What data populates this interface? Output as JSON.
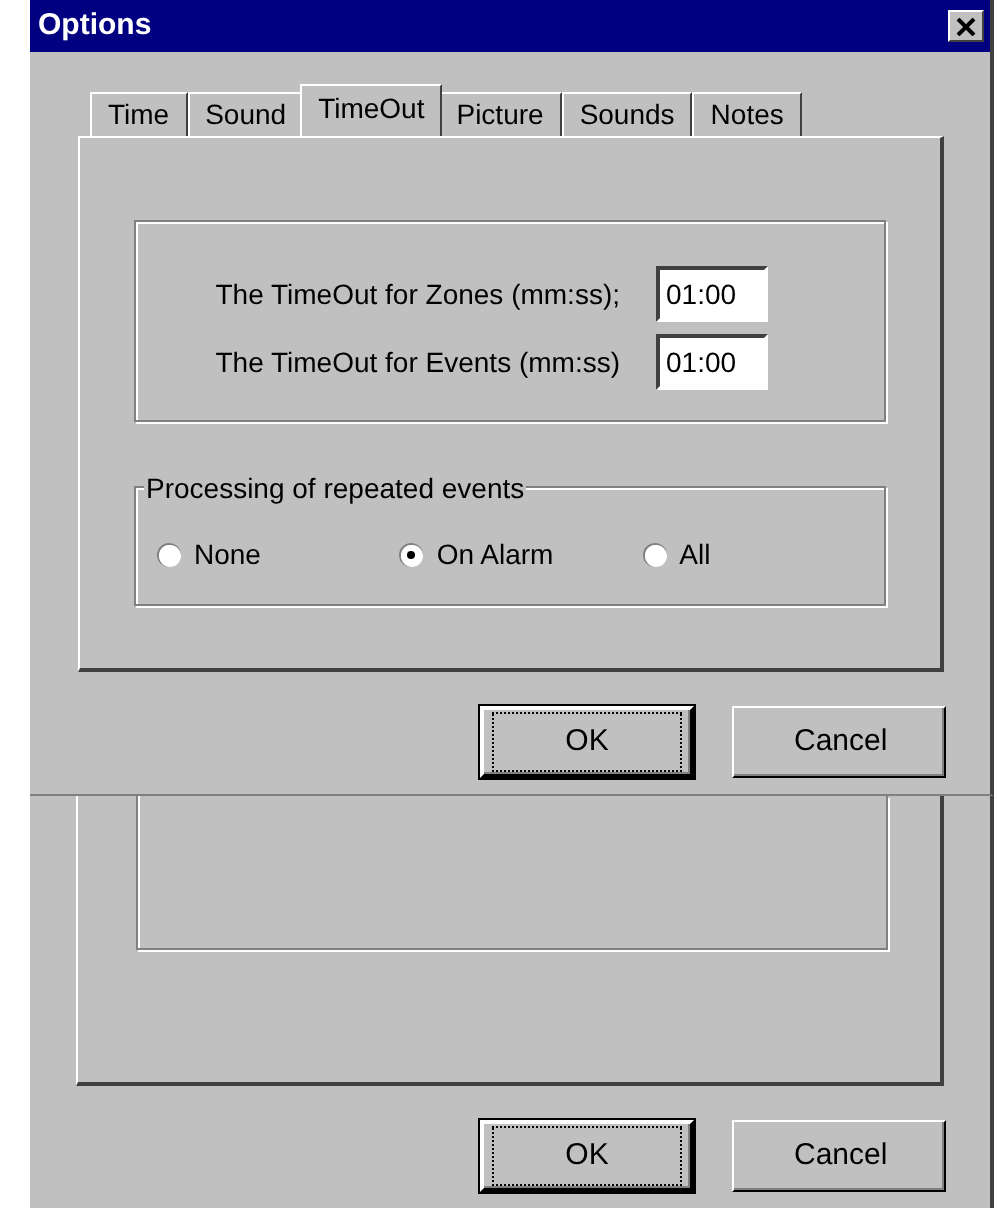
{
  "window": {
    "title": "Options"
  },
  "tabs": [
    {
      "label": "Time",
      "selected": false
    },
    {
      "label": "Sound",
      "selected": false
    },
    {
      "label": "TimeOut",
      "selected": true
    },
    {
      "label": "Picture",
      "selected": false
    },
    {
      "label": "Sounds",
      "selected": false
    },
    {
      "label": "Notes",
      "selected": false
    }
  ],
  "timeouts": [
    {
      "label": "The TimeOut for Zones (mm:ss);",
      "value": "01:00"
    },
    {
      "label": "The TimeOut for Events (mm:ss)",
      "value": "01:00"
    }
  ],
  "repeated_events": {
    "title": "Processing of repeated events",
    "options": [
      {
        "label": "None",
        "selected": false
      },
      {
        "label": "On Alarm",
        "selected": true
      },
      {
        "label": "All",
        "selected": false
      }
    ]
  },
  "buttons": [
    {
      "label": "OK",
      "default": true
    },
    {
      "label": "Cancel",
      "default": false
    }
  ],
  "background_window": {
    "buttons": [
      {
        "label": "OK",
        "default": true
      },
      {
        "label": "Cancel",
        "default": false
      }
    ]
  }
}
